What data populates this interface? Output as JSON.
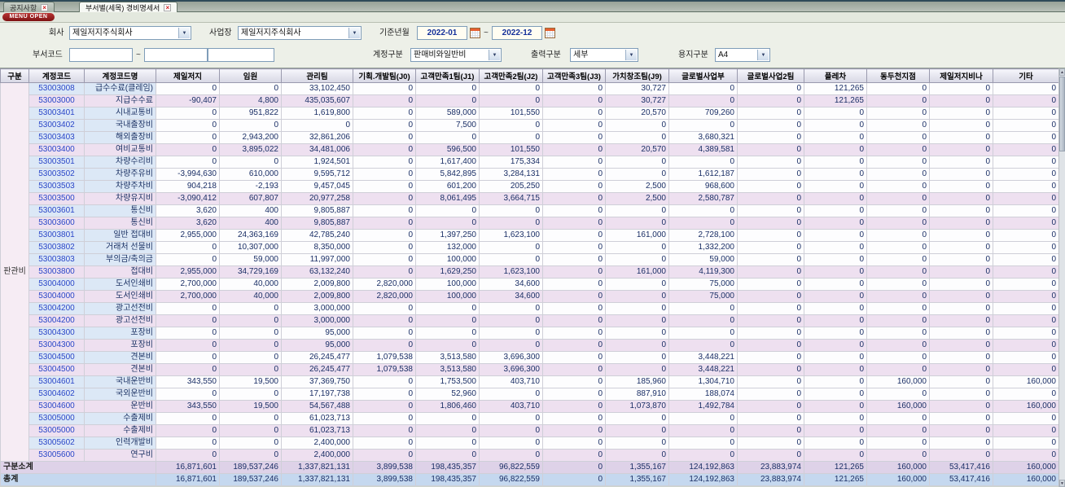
{
  "tabs": [
    {
      "label": "공지사항"
    },
    {
      "label": "부서별(세목) 경비명세서"
    }
  ],
  "menu_open_label": "MENU OPEN",
  "filters": {
    "company_label": "회사",
    "company_value": "제일저지주식회사",
    "site_label": "사업장",
    "site_value": "제일저지주식회사",
    "period_label": "기준년월",
    "period_from": "2022-01",
    "period_to": "2022-12",
    "tilde": "~",
    "dept_label": "부서코드",
    "dept_from": "",
    "dept_to": "",
    "dept_name": "",
    "account_label": "계정구분",
    "account_value": "판매비와일반비",
    "output_label": "출력구분",
    "output_value": "세부",
    "paper_label": "용지구분",
    "paper_value": "A4"
  },
  "table": {
    "group_label": "판관비",
    "columns": [
      "구분",
      "계정코드",
      "계정코드명",
      "제일저지",
      "임원",
      "관리팀",
      "기획.개발팀(J0)",
      "고객만족1팀(J1)",
      "고객만족2팀(J2)",
      "고객만족3팀(J3)",
      "가치창조팀(J9)",
      "글로벌사업부",
      "글로벌사업2팀",
      "플레차",
      "동두천지점",
      "제일저지비나",
      "기타"
    ],
    "rows": [
      {
        "code": "53003008",
        "name": "급수수료(클레임)",
        "type": "detail",
        "values": [
          "0",
          "0",
          "33,102,450",
          "0",
          "0",
          "0",
          "0",
          "30,727",
          "0",
          "0",
          "121,265",
          "0",
          "0",
          "0"
        ]
      },
      {
        "code": "53003000",
        "name": "지급수수료",
        "type": "summary",
        "values": [
          "-90,407",
          "4,800",
          "435,035,607",
          "0",
          "0",
          "0",
          "0",
          "30,727",
          "0",
          "0",
          "121,265",
          "0",
          "0",
          "0"
        ]
      },
      {
        "code": "53003401",
        "name": "시내교통비",
        "type": "detail",
        "values": [
          "0",
          "951,822",
          "1,619,800",
          "0",
          "589,000",
          "101,550",
          "0",
          "20,570",
          "709,260",
          "0",
          "0",
          "0",
          "0",
          "0"
        ]
      },
      {
        "code": "53003402",
        "name": "국내출장비",
        "type": "detail",
        "values": [
          "0",
          "0",
          "0",
          "0",
          "7,500",
          "0",
          "0",
          "0",
          "0",
          "0",
          "0",
          "0",
          "0",
          "0"
        ]
      },
      {
        "code": "53003403",
        "name": "해외출장비",
        "type": "detail",
        "values": [
          "0",
          "2,943,200",
          "32,861,206",
          "0",
          "0",
          "0",
          "0",
          "0",
          "3,680,321",
          "0",
          "0",
          "0",
          "0",
          "0"
        ]
      },
      {
        "code": "53003400",
        "name": "여비교통비",
        "type": "summary",
        "values": [
          "0",
          "3,895,022",
          "34,481,006",
          "0",
          "596,500",
          "101,550",
          "0",
          "20,570",
          "4,389,581",
          "0",
          "0",
          "0",
          "0",
          "0"
        ]
      },
      {
        "code": "53003501",
        "name": "차량수리비",
        "type": "detail",
        "values": [
          "0",
          "0",
          "1,924,501",
          "0",
          "1,617,400",
          "175,334",
          "0",
          "0",
          "0",
          "0",
          "0",
          "0",
          "0",
          "0"
        ]
      },
      {
        "code": "53003502",
        "name": "차량주유비",
        "type": "detail",
        "values": [
          "-3,994,630",
          "610,000",
          "9,595,712",
          "0",
          "5,842,895",
          "3,284,131",
          "0",
          "0",
          "1,612,187",
          "0",
          "0",
          "0",
          "0",
          "0"
        ]
      },
      {
        "code": "53003503",
        "name": "차량주차비",
        "type": "detail",
        "values": [
          "904,218",
          "-2,193",
          "9,457,045",
          "0",
          "601,200",
          "205,250",
          "0",
          "2,500",
          "968,600",
          "0",
          "0",
          "0",
          "0",
          "0"
        ]
      },
      {
        "code": "53003500",
        "name": "차량유지비",
        "type": "summary",
        "values": [
          "-3,090,412",
          "607,807",
          "20,977,258",
          "0",
          "8,061,495",
          "3,664,715",
          "0",
          "2,500",
          "2,580,787",
          "0",
          "0",
          "0",
          "0",
          "0"
        ]
      },
      {
        "code": "53003601",
        "name": "통신비",
        "type": "detail",
        "values": [
          "3,620",
          "400",
          "9,805,887",
          "0",
          "0",
          "0",
          "0",
          "0",
          "0",
          "0",
          "0",
          "0",
          "0",
          "0"
        ]
      },
      {
        "code": "53003600",
        "name": "통신비",
        "type": "summary",
        "values": [
          "3,620",
          "400",
          "9,805,887",
          "0",
          "0",
          "0",
          "0",
          "0",
          "0",
          "0",
          "0",
          "0",
          "0",
          "0"
        ]
      },
      {
        "code": "53003801",
        "name": "일반 접대비",
        "type": "detail",
        "values": [
          "2,955,000",
          "24,363,169",
          "42,785,240",
          "0",
          "1,397,250",
          "1,623,100",
          "0",
          "161,000",
          "2,728,100",
          "0",
          "0",
          "0",
          "0",
          "0"
        ]
      },
      {
        "code": "53003802",
        "name": "거래처 선물비",
        "type": "detail",
        "values": [
          "0",
          "10,307,000",
          "8,350,000",
          "0",
          "132,000",
          "0",
          "0",
          "0",
          "1,332,200",
          "0",
          "0",
          "0",
          "0",
          "0"
        ]
      },
      {
        "code": "53003803",
        "name": "부의금/축의금",
        "type": "detail",
        "values": [
          "0",
          "59,000",
          "11,997,000",
          "0",
          "100,000",
          "0",
          "0",
          "0",
          "59,000",
          "0",
          "0",
          "0",
          "0",
          "0"
        ]
      },
      {
        "code": "53003800",
        "name": "접대비",
        "type": "summary",
        "values": [
          "2,955,000",
          "34,729,169",
          "63,132,240",
          "0",
          "1,629,250",
          "1,623,100",
          "0",
          "161,000",
          "4,119,300",
          "0",
          "0",
          "0",
          "0",
          "0"
        ]
      },
      {
        "code": "53004000",
        "name": "도서인쇄비",
        "type": "detail",
        "values": [
          "2,700,000",
          "40,000",
          "2,009,800",
          "2,820,000",
          "100,000",
          "34,600",
          "0",
          "0",
          "75,000",
          "0",
          "0",
          "0",
          "0",
          "0"
        ]
      },
      {
        "code": "53004000",
        "name": "도서인쇄비",
        "type": "summary",
        "values": [
          "2,700,000",
          "40,000",
          "2,009,800",
          "2,820,000",
          "100,000",
          "34,600",
          "0",
          "0",
          "75,000",
          "0",
          "0",
          "0",
          "0",
          "0"
        ]
      },
      {
        "code": "53004200",
        "name": "광고선전비",
        "type": "detail",
        "values": [
          "0",
          "0",
          "3,000,000",
          "0",
          "0",
          "0",
          "0",
          "0",
          "0",
          "0",
          "0",
          "0",
          "0",
          "0"
        ]
      },
      {
        "code": "53004200",
        "name": "광고선전비",
        "type": "summary",
        "values": [
          "0",
          "0",
          "3,000,000",
          "0",
          "0",
          "0",
          "0",
          "0",
          "0",
          "0",
          "0",
          "0",
          "0",
          "0"
        ]
      },
      {
        "code": "53004300",
        "name": "포장비",
        "type": "detail",
        "values": [
          "0",
          "0",
          "95,000",
          "0",
          "0",
          "0",
          "0",
          "0",
          "0",
          "0",
          "0",
          "0",
          "0",
          "0"
        ]
      },
      {
        "code": "53004300",
        "name": "포장비",
        "type": "summary",
        "values": [
          "0",
          "0",
          "95,000",
          "0",
          "0",
          "0",
          "0",
          "0",
          "0",
          "0",
          "0",
          "0",
          "0",
          "0"
        ]
      },
      {
        "code": "53004500",
        "name": "견본비",
        "type": "detail",
        "values": [
          "0",
          "0",
          "26,245,477",
          "1,079,538",
          "3,513,580",
          "3,696,300",
          "0",
          "0",
          "3,448,221",
          "0",
          "0",
          "0",
          "0",
          "0"
        ]
      },
      {
        "code": "53004500",
        "name": "견본비",
        "type": "summary",
        "values": [
          "0",
          "0",
          "26,245,477",
          "1,079,538",
          "3,513,580",
          "3,696,300",
          "0",
          "0",
          "3,448,221",
          "0",
          "0",
          "0",
          "0",
          "0"
        ]
      },
      {
        "code": "53004601",
        "name": "국내운반비",
        "type": "detail",
        "values": [
          "343,550",
          "19,500",
          "37,369,750",
          "0",
          "1,753,500",
          "403,710",
          "0",
          "185,960",
          "1,304,710",
          "0",
          "0",
          "160,000",
          "0",
          "160,000"
        ]
      },
      {
        "code": "53004602",
        "name": "국외운반비",
        "type": "detail",
        "values": [
          "0",
          "0",
          "17,197,738",
          "0",
          "52,960",
          "0",
          "0",
          "887,910",
          "188,074",
          "0",
          "0",
          "0",
          "0",
          "0"
        ]
      },
      {
        "code": "53004600",
        "name": "운반비",
        "type": "summary",
        "values": [
          "343,550",
          "19,500",
          "54,567,488",
          "0",
          "1,806,460",
          "403,710",
          "0",
          "1,073,870",
          "1,492,784",
          "0",
          "0",
          "160,000",
          "0",
          "160,000"
        ]
      },
      {
        "code": "53005000",
        "name": "수출제비",
        "type": "detail",
        "values": [
          "0",
          "0",
          "61,023,713",
          "0",
          "0",
          "0",
          "0",
          "0",
          "0",
          "0",
          "0",
          "0",
          "0",
          "0"
        ]
      },
      {
        "code": "53005000",
        "name": "수출제비",
        "type": "summary",
        "values": [
          "0",
          "0",
          "61,023,713",
          "0",
          "0",
          "0",
          "0",
          "0",
          "0",
          "0",
          "0",
          "0",
          "0",
          "0"
        ]
      },
      {
        "code": "53005602",
        "name": "인력개발비",
        "type": "detail",
        "values": [
          "0",
          "0",
          "2,400,000",
          "0",
          "0",
          "0",
          "0",
          "0",
          "0",
          "0",
          "0",
          "0",
          "0",
          "0"
        ]
      },
      {
        "code": "53005600",
        "name": "연구비",
        "type": "summary",
        "values": [
          "0",
          "0",
          "2,400,000",
          "0",
          "0",
          "0",
          "0",
          "0",
          "0",
          "0",
          "0",
          "0",
          "0",
          "0"
        ]
      }
    ],
    "subtotal": {
      "label": "구분소계",
      "values": [
        "16,871,601",
        "189,537,246",
        "1,337,821,131",
        "3,899,538",
        "198,435,357",
        "96,822,559",
        "0",
        "1,355,167",
        "124,192,863",
        "23,883,974",
        "121,265",
        "160,000",
        "53,417,416",
        "160,000"
      ]
    },
    "total": {
      "label": "총계",
      "values": [
        "16,871,601",
        "189,537,246",
        "1,337,821,131",
        "3,899,538",
        "198,435,357",
        "96,822,559",
        "0",
        "1,355,167",
        "124,192,863",
        "23,883,974",
        "121,265",
        "160,000",
        "53,417,416",
        "160,000"
      ]
    }
  }
}
